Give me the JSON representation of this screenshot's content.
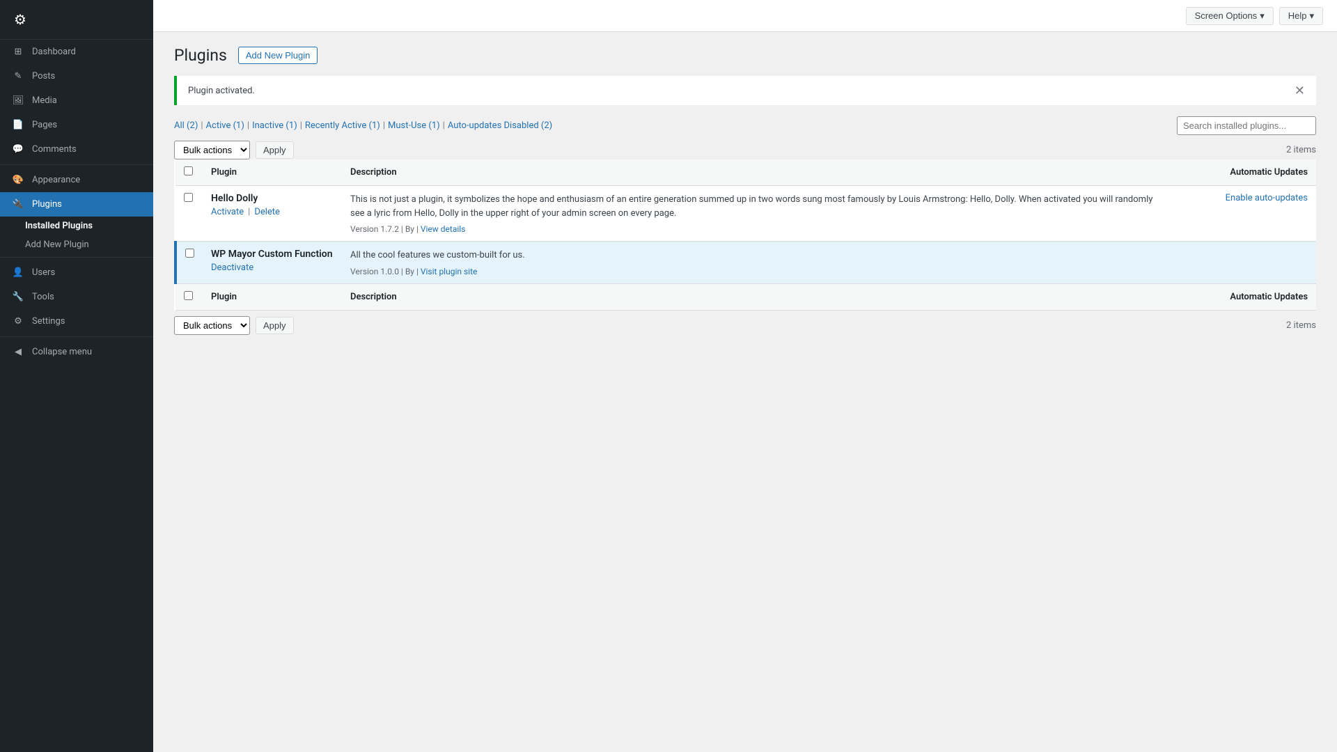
{
  "sidebar": {
    "items": [
      {
        "id": "dashboard",
        "label": "Dashboard",
        "icon": "⊞"
      },
      {
        "id": "posts",
        "label": "Posts",
        "icon": "✎"
      },
      {
        "id": "media",
        "label": "Media",
        "icon": "⊟"
      },
      {
        "id": "pages",
        "label": "Pages",
        "icon": "📄"
      },
      {
        "id": "comments",
        "label": "Comments",
        "icon": "💬"
      },
      {
        "id": "appearance",
        "label": "Appearance",
        "icon": "🎨"
      },
      {
        "id": "plugins",
        "label": "Plugins",
        "icon": "🔌",
        "active": true
      },
      {
        "id": "users",
        "label": "Users",
        "icon": "👤"
      },
      {
        "id": "tools",
        "label": "Tools",
        "icon": "🔧"
      },
      {
        "id": "settings",
        "label": "Settings",
        "icon": "⚙"
      }
    ],
    "plugins_sub": [
      {
        "id": "installed-plugins",
        "label": "Installed Plugins",
        "active": true
      },
      {
        "id": "add-new-plugin",
        "label": "Add New Plugin"
      }
    ],
    "collapse_label": "Collapse menu"
  },
  "topbar": {
    "screen_options_label": "Screen Options",
    "help_label": "Help"
  },
  "page": {
    "title": "Plugins",
    "add_new_label": "Add New Plugin"
  },
  "notice": {
    "text": "Plugin activated.",
    "close_title": "Dismiss"
  },
  "filters": {
    "all_label": "All",
    "all_count": "2",
    "active_label": "Active",
    "active_count": "1",
    "inactive_label": "Inactive",
    "inactive_count": "1",
    "recently_active_label": "Recently Active",
    "recently_active_count": "1",
    "must_use_label": "Must-Use",
    "must_use_count": "1",
    "auto_updates_disabled_label": "Auto-updates Disabled",
    "auto_updates_disabled_count": "2"
  },
  "toolbar_top": {
    "bulk_actions_label": "Bulk actions",
    "apply_label": "Apply",
    "items_count": "2 items",
    "search_placeholder": "Search installed plugins..."
  },
  "table": {
    "col_plugin": "Plugin",
    "col_description": "Description",
    "col_auto_updates": "Automatic Updates"
  },
  "plugins": [
    {
      "id": "hello-dolly",
      "name": "Hello Dolly",
      "active": false,
      "actions": [
        {
          "label": "Activate",
          "type": "activate"
        },
        {
          "label": "Delete",
          "type": "delete"
        }
      ],
      "description": "This is not just a plugin, it symbolizes the hope and enthusiasm of an entire generation summed up in two words sung most famously by Louis Armstrong: Hello, Dolly. When activated you will randomly see a lyric from Hello, Dolly in the upper right of your admin screen on every page.",
      "version": "1.7.2",
      "by_label": "By",
      "by_author": "",
      "view_details_label": "View details",
      "auto_updates_label": "Enable auto-updates"
    },
    {
      "id": "wp-mayor-custom-function",
      "name": "WP Mayor Custom Function",
      "active": true,
      "actions": [
        {
          "label": "Deactivate",
          "type": "deactivate"
        }
      ],
      "description": "All the cool features we custom-built for us.",
      "version": "1.0.0",
      "by_label": "By",
      "by_author": "",
      "visit_plugin_site_label": "Visit plugin site",
      "auto_updates_label": ""
    }
  ],
  "toolbar_bottom": {
    "bulk_actions_label": "Bulk actions",
    "apply_label": "Apply",
    "items_count": "2 items"
  }
}
